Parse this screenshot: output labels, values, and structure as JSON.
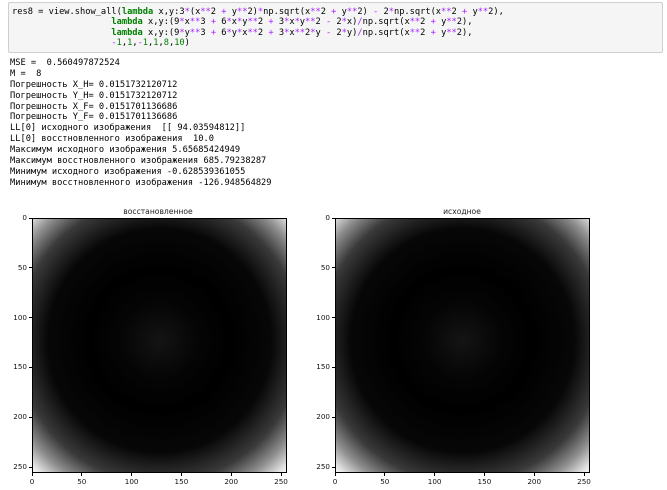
{
  "code": {
    "lines": [
      [
        {
          "t": "res8 = view.show_all(",
          "c": ""
        },
        {
          "t": "lambda",
          "c": "kw"
        },
        {
          "t": " x,y:3",
          "c": ""
        },
        {
          "t": "*",
          "c": "op"
        },
        {
          "t": "(x",
          "c": ""
        },
        {
          "t": "**",
          "c": "op"
        },
        {
          "t": "2 ",
          "c": ""
        },
        {
          "t": "+",
          "c": "op"
        },
        {
          "t": " y",
          "c": ""
        },
        {
          "t": "**",
          "c": "op"
        },
        {
          "t": "2)",
          "c": ""
        },
        {
          "t": "*",
          "c": "op"
        },
        {
          "t": "np.sqrt(x",
          "c": ""
        },
        {
          "t": "**",
          "c": "op"
        },
        {
          "t": "2 ",
          "c": ""
        },
        {
          "t": "+",
          "c": "op"
        },
        {
          "t": " y",
          "c": ""
        },
        {
          "t": "**",
          "c": "op"
        },
        {
          "t": "2) ",
          "c": ""
        },
        {
          "t": "-",
          "c": "op"
        },
        {
          "t": " 2",
          "c": ""
        },
        {
          "t": "*",
          "c": "op"
        },
        {
          "t": "np.sqrt(x",
          "c": ""
        },
        {
          "t": "**",
          "c": "op"
        },
        {
          "t": "2 ",
          "c": ""
        },
        {
          "t": "+",
          "c": "op"
        },
        {
          "t": " y",
          "c": ""
        },
        {
          "t": "**",
          "c": "op"
        },
        {
          "t": "2),",
          "c": ""
        }
      ],
      [
        {
          "t": "                   ",
          "c": ""
        },
        {
          "t": "lambda",
          "c": "kw"
        },
        {
          "t": " x,y:(9",
          "c": ""
        },
        {
          "t": "*",
          "c": "op"
        },
        {
          "t": "x",
          "c": ""
        },
        {
          "t": "**",
          "c": "op"
        },
        {
          "t": "3 ",
          "c": ""
        },
        {
          "t": "+",
          "c": "op"
        },
        {
          "t": " 6",
          "c": ""
        },
        {
          "t": "*",
          "c": "op"
        },
        {
          "t": "x",
          "c": ""
        },
        {
          "t": "*",
          "c": "op"
        },
        {
          "t": "y",
          "c": ""
        },
        {
          "t": "**",
          "c": "op"
        },
        {
          "t": "2 ",
          "c": ""
        },
        {
          "t": "+",
          "c": "op"
        },
        {
          "t": " 3",
          "c": ""
        },
        {
          "t": "*",
          "c": "op"
        },
        {
          "t": "x",
          "c": ""
        },
        {
          "t": "*",
          "c": "op"
        },
        {
          "t": "y",
          "c": ""
        },
        {
          "t": "**",
          "c": "op"
        },
        {
          "t": "2 ",
          "c": ""
        },
        {
          "t": "-",
          "c": "op"
        },
        {
          "t": " 2",
          "c": ""
        },
        {
          "t": "*",
          "c": "op"
        },
        {
          "t": "x)",
          "c": ""
        },
        {
          "t": "/",
          "c": "op"
        },
        {
          "t": "np.sqrt(x",
          "c": ""
        },
        {
          "t": "**",
          "c": "op"
        },
        {
          "t": "2 ",
          "c": ""
        },
        {
          "t": "+",
          "c": "op"
        },
        {
          "t": " y",
          "c": ""
        },
        {
          "t": "**",
          "c": "op"
        },
        {
          "t": "2),",
          "c": ""
        }
      ],
      [
        {
          "t": "                   ",
          "c": ""
        },
        {
          "t": "lambda",
          "c": "kw"
        },
        {
          "t": " x,y:(9",
          "c": ""
        },
        {
          "t": "*",
          "c": "op"
        },
        {
          "t": "y",
          "c": ""
        },
        {
          "t": "**",
          "c": "op"
        },
        {
          "t": "3 ",
          "c": ""
        },
        {
          "t": "+",
          "c": "op"
        },
        {
          "t": " 6",
          "c": ""
        },
        {
          "t": "*",
          "c": "op"
        },
        {
          "t": "y",
          "c": ""
        },
        {
          "t": "*",
          "c": "op"
        },
        {
          "t": "x",
          "c": ""
        },
        {
          "t": "**",
          "c": "op"
        },
        {
          "t": "2 ",
          "c": ""
        },
        {
          "t": "+",
          "c": "op"
        },
        {
          "t": " 3",
          "c": ""
        },
        {
          "t": "*",
          "c": "op"
        },
        {
          "t": "x",
          "c": ""
        },
        {
          "t": "**",
          "c": "op"
        },
        {
          "t": "2",
          "c": ""
        },
        {
          "t": "*",
          "c": "op"
        },
        {
          "t": "y ",
          "c": ""
        },
        {
          "t": "-",
          "c": "op"
        },
        {
          "t": " 2",
          "c": ""
        },
        {
          "t": "*",
          "c": "op"
        },
        {
          "t": "y)",
          "c": ""
        },
        {
          "t": "/",
          "c": "op"
        },
        {
          "t": "np.sqrt(x",
          "c": ""
        },
        {
          "t": "**",
          "c": "op"
        },
        {
          "t": "2 ",
          "c": ""
        },
        {
          "t": "+",
          "c": "op"
        },
        {
          "t": " y",
          "c": ""
        },
        {
          "t": "**",
          "c": "op"
        },
        {
          "t": "2),",
          "c": ""
        }
      ],
      [
        {
          "t": "                   ",
          "c": ""
        },
        {
          "t": "-",
          "c": "op"
        },
        {
          "t": "1",
          "c": "num"
        },
        {
          "t": ",",
          "c": ""
        },
        {
          "t": "1",
          "c": "num"
        },
        {
          "t": ",",
          "c": ""
        },
        {
          "t": "-",
          "c": "op"
        },
        {
          "t": "1",
          "c": "num"
        },
        {
          "t": ",",
          "c": ""
        },
        {
          "t": "1",
          "c": "num"
        },
        {
          "t": ",",
          "c": ""
        },
        {
          "t": "8",
          "c": "num"
        },
        {
          "t": ",",
          "c": ""
        },
        {
          "t": "10",
          "c": "num"
        },
        {
          "t": ")",
          "c": ""
        }
      ]
    ]
  },
  "output": {
    "lines": [
      "MSE =  0.560497872524",
      "M =  8",
      "Погрешность X_H= 0.0151732120712",
      "Погрешность Y_H= 0.0151732120712",
      "Погрешность X_F= 0.0151701136686",
      "Погрешность Y_F= 0.0151701136686",
      "LL[0] исходного изображения  [[ 94.03594812]]",
      "LL[0] восстновленного изображения  10.0",
      "Максимум исходного изображения 5.65685424949",
      "Максимум восстновленного изображения 685.79238287",
      "Минимум исходного изображения -0.628539361055",
      "Минимум восстновленного изображения -126.948564829"
    ]
  },
  "colors": {
    "cell_bg": "#f5f5f5",
    "cell_border": "#cfcfcf",
    "keyword": "#008000",
    "operator": "#aa22ff"
  },
  "figure": {
    "subplots": [
      {
        "title": "восстановленное"
      },
      {
        "title": "исходное"
      }
    ],
    "x_ticks": [
      "0",
      "50",
      "100",
      "150",
      "200",
      "250"
    ],
    "y_ticks": [
      "0",
      "50",
      "100",
      "150",
      "200",
      "250"
    ]
  }
}
